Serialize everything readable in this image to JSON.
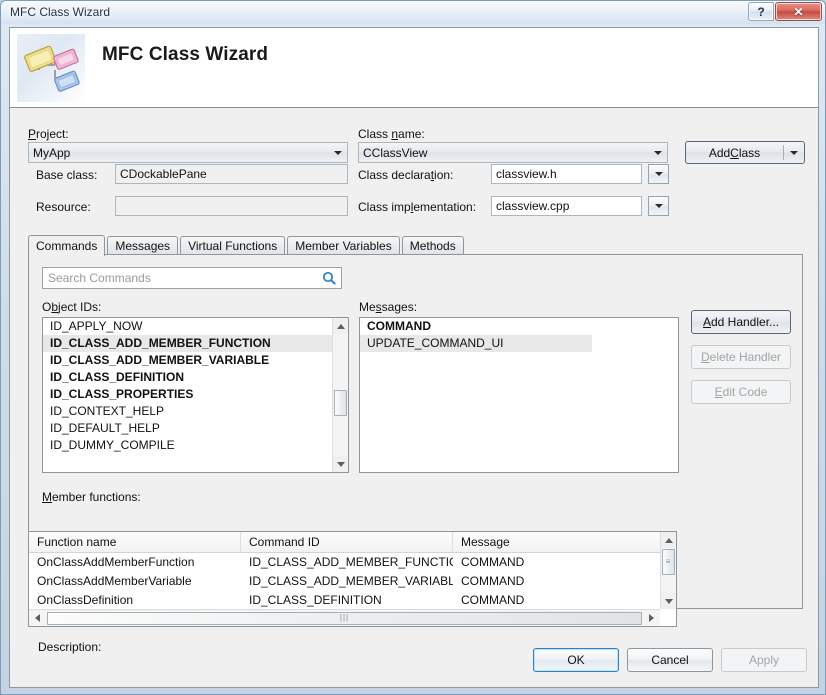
{
  "window": {
    "title": "MFC Class Wizard",
    "help_button": "?",
    "close_button": "✕"
  },
  "banner": {
    "title": "MFC Class Wizard",
    "icon": "class-hierarchy-icon"
  },
  "fields": {
    "project_label": "Project:",
    "project_label_accel": "P",
    "project_value": "MyApp",
    "class_name_label": "Class name:",
    "class_name_accel": "n",
    "class_name_value": "CClassView",
    "base_class_label": "Base class:",
    "base_class_value": "CDockablePane",
    "resource_label": "Resource:",
    "resource_value": "",
    "class_declaration_label": "Class declaration:",
    "class_declaration_value": "classview.h",
    "class_implementation_label": "Class implementation:",
    "class_implementation_value": "classview.cpp",
    "add_class_label": "Add Class",
    "add_class_accel": "C"
  },
  "tabs": [
    {
      "label": "Commands",
      "active": true
    },
    {
      "label": "Messages",
      "active": false
    },
    {
      "label": "Virtual Functions",
      "active": false
    },
    {
      "label": "Member Variables",
      "active": false
    },
    {
      "label": "Methods",
      "active": false
    }
  ],
  "search": {
    "placeholder": "Search Commands",
    "value": "",
    "icon": "search-icon"
  },
  "object_ids": {
    "label": "Object IDs:",
    "label_accel": "b",
    "items": [
      {
        "text": "ID_APPLY_NOW",
        "bold": false,
        "selected": false
      },
      {
        "text": "ID_CLASS_ADD_MEMBER_FUNCTION",
        "bold": true,
        "selected": true
      },
      {
        "text": "ID_CLASS_ADD_MEMBER_VARIABLE",
        "bold": true,
        "selected": false
      },
      {
        "text": "ID_CLASS_DEFINITION",
        "bold": true,
        "selected": false
      },
      {
        "text": "ID_CLASS_PROPERTIES",
        "bold": true,
        "selected": false
      },
      {
        "text": "ID_CONTEXT_HELP",
        "bold": false,
        "selected": false
      },
      {
        "text": "ID_DEFAULT_HELP",
        "bold": false,
        "selected": false
      },
      {
        "text": "ID_DUMMY_COMPILE",
        "bold": false,
        "selected": false
      }
    ]
  },
  "messages": {
    "label": "Messages:",
    "label_accel": "s",
    "items": [
      {
        "text": "COMMAND",
        "bold": true,
        "selected": false
      },
      {
        "text": "UPDATE_COMMAND_UI",
        "bold": false,
        "selected": true
      }
    ]
  },
  "handler_buttons": [
    {
      "label": "Add Handler...",
      "accel": "A",
      "enabled": true,
      "default": true
    },
    {
      "label": "Delete Handler",
      "accel": "D",
      "enabled": false,
      "default": false
    },
    {
      "label": "Edit Code",
      "accel": "E",
      "enabled": false,
      "default": false
    }
  ],
  "member_functions": {
    "label": "Member functions:",
    "label_accel": "M",
    "columns": [
      "Function name",
      "Command ID",
      "Message"
    ],
    "rows": [
      [
        "OnClassAddMemberFunction",
        "ID_CLASS_ADD_MEMBER_FUNCTION",
        "COMMAND"
      ],
      [
        "OnClassAddMemberVariable",
        "ID_CLASS_ADD_MEMBER_VARIABLE",
        "COMMAND"
      ],
      [
        "OnClassDefinition",
        "ID_CLASS_DEFINITION",
        "COMMAND"
      ]
    ]
  },
  "description": {
    "label": "Description:",
    "text": ""
  },
  "dialog_buttons": [
    {
      "label": "OK",
      "enabled": true,
      "default": true
    },
    {
      "label": "Cancel",
      "enabled": true,
      "default": false
    },
    {
      "label": "Apply",
      "enabled": false,
      "default": false
    }
  ]
}
